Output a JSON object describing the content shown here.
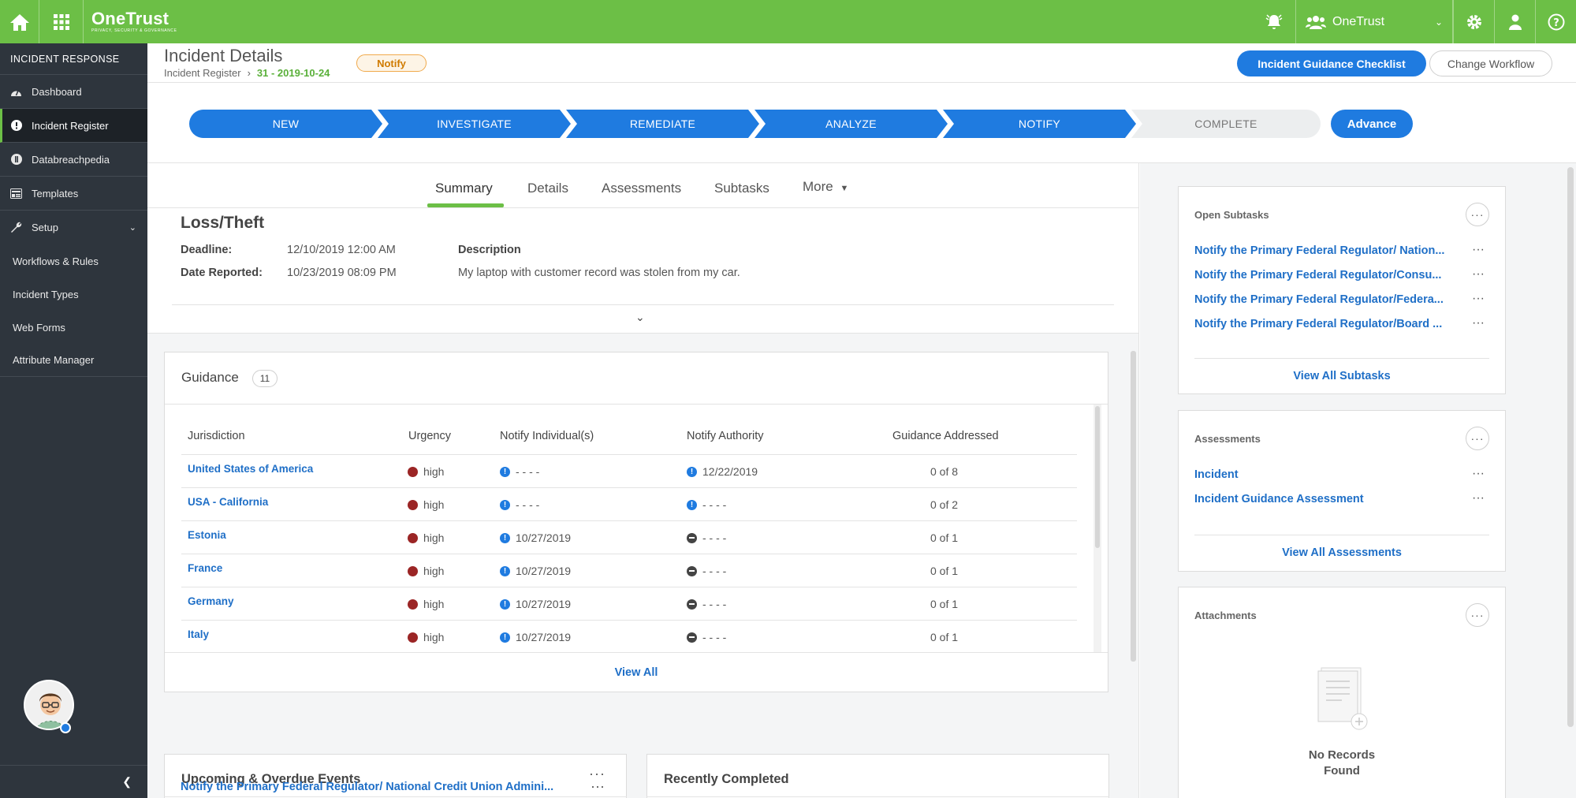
{
  "brand": {
    "name": "OneTrust",
    "tagline": "PRIVACY, SECURITY & GOVERNANCE"
  },
  "topbar": {
    "org_name": "OneTrust"
  },
  "sidebar": {
    "header": "INCIDENT RESPONSE",
    "items": [
      {
        "label": "Dashboard",
        "icon": "dashboard-icon"
      },
      {
        "label": "Incident Register",
        "icon": "alert-circle-icon",
        "active": true
      },
      {
        "label": "Databreachpedia",
        "icon": "book-icon"
      },
      {
        "label": "Templates",
        "icon": "template-icon"
      },
      {
        "label": "Setup",
        "icon": "wrench-icon",
        "expanded": true
      }
    ],
    "setup_items": [
      {
        "label": "Workflows & Rules"
      },
      {
        "label": "Incident Types"
      },
      {
        "label": "Web Forms"
      },
      {
        "label": "Attribute Manager"
      }
    ]
  },
  "header": {
    "title": "Incident Details",
    "breadcrumb_parent": "Incident Register",
    "breadcrumb_current": "31 - 2019-10-24",
    "stage_badge": "Notify",
    "checklist_button": "Incident Guidance Checklist",
    "change_workflow_button": "Change Workflow"
  },
  "workflow": {
    "steps": [
      "NEW",
      "INVESTIGATE",
      "REMEDIATE",
      "ANALYZE",
      "NOTIFY",
      "COMPLETE"
    ],
    "current_step": "NOTIFY",
    "advance_button": "Advance"
  },
  "tabs": [
    {
      "label": "Summary",
      "active": true
    },
    {
      "label": "Details"
    },
    {
      "label": "Assessments"
    },
    {
      "label": "Subtasks"
    },
    {
      "label": "More"
    }
  ],
  "summary": {
    "title": "Loss/Theft",
    "deadline_label": "Deadline:",
    "deadline_value": "12/10/2019 12:00 AM",
    "reported_label": "Date Reported:",
    "reported_value": "10/23/2019 08:09 PM",
    "description_label": "Description",
    "description_value": "My laptop with customer record was stolen from my car."
  },
  "guidance": {
    "title": "Guidance",
    "count": "11",
    "columns": [
      "Jurisdiction",
      "Urgency",
      "Notify Individual(s)",
      "Notify Authority",
      "Guidance Addressed"
    ],
    "rows": [
      {
        "jurisdiction": "United States of America",
        "urgency": "high",
        "individuals": "- - - -",
        "individuals_icon": "info",
        "authority": "12/22/2019",
        "authority_icon": "info",
        "addressed": "0 of 8"
      },
      {
        "jurisdiction": "USA - California",
        "urgency": "high",
        "individuals": "- - - -",
        "individuals_icon": "info",
        "authority": "- - - -",
        "authority_icon": "info",
        "addressed": "0 of 2"
      },
      {
        "jurisdiction": "Estonia",
        "urgency": "high",
        "individuals": "10/27/2019",
        "individuals_icon": "info",
        "authority": "- - - -",
        "authority_icon": "minus",
        "addressed": "0 of 1"
      },
      {
        "jurisdiction": "France",
        "urgency": "high",
        "individuals": "10/27/2019",
        "individuals_icon": "info",
        "authority": "- - - -",
        "authority_icon": "minus",
        "addressed": "0 of 1"
      },
      {
        "jurisdiction": "Germany",
        "urgency": "high",
        "individuals": "10/27/2019",
        "individuals_icon": "info",
        "authority": "- - - -",
        "authority_icon": "minus",
        "addressed": "0 of 1"
      },
      {
        "jurisdiction": "Italy",
        "urgency": "high",
        "individuals": "10/27/2019",
        "individuals_icon": "info",
        "authority": "- - - -",
        "authority_icon": "minus",
        "addressed": "0 of 1"
      }
    ],
    "view_all": "View All"
  },
  "events": {
    "title": "Upcoming & Overdue Events",
    "first_item": "Notify the Primary Federal Regulator/ National Credit Union Admini..."
  },
  "recently_completed": {
    "title": "Recently Completed"
  },
  "open_subtasks": {
    "title": "Open Subtasks",
    "items": [
      "Notify the Primary Federal Regulator/ Nation...",
      "Notify the Primary Federal Regulator/Consu...",
      "Notify the Primary Federal Regulator/Federa...",
      "Notify the Primary Federal Regulator/Board ..."
    ],
    "view_all": "View All Subtasks"
  },
  "assessments": {
    "title": "Assessments",
    "items": [
      "Incident",
      "Incident Guidance Assessment"
    ],
    "view_all": "View All Assessments"
  },
  "attachments": {
    "title": "Attachments",
    "empty_line1": "No Records",
    "empty_line2": "Found"
  },
  "colors": {
    "brand_green": "#6cbf46",
    "primary_blue": "#1f7be0",
    "sidebar_bg": "#2e353d",
    "urgency_high": "#9b2525",
    "notify_badge": "#f0a94b"
  }
}
